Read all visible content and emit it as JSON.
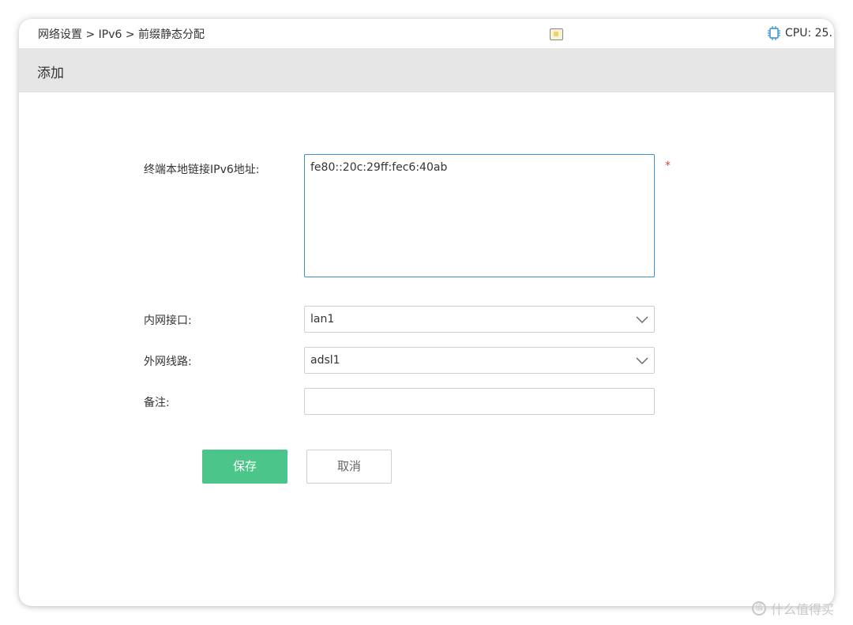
{
  "breadcrumb": "网络设置 > IPv6 > 前缀静态分配",
  "cpu": {
    "label": "CPU: 25."
  },
  "header": {
    "title": "添加"
  },
  "form": {
    "ipv6_label": "终端本地链接IPv6地址:",
    "ipv6_value": "fe80::20c:29ff:fec6:40ab",
    "required_mark": "*",
    "lan_label": "内网接口:",
    "lan_value": "lan1",
    "wan_label": "外网线路:",
    "wan_value": "adsl1",
    "note_label": "备注:",
    "note_value": ""
  },
  "buttons": {
    "save": "保存",
    "cancel": "取消"
  },
  "watermark": {
    "text": "什么值得买",
    "logo": "值"
  },
  "colors": {
    "accent": "#4cc58a",
    "focus_border": "#3d8fd6",
    "required": "#e0443b",
    "header_bg": "#e6e6e6"
  }
}
